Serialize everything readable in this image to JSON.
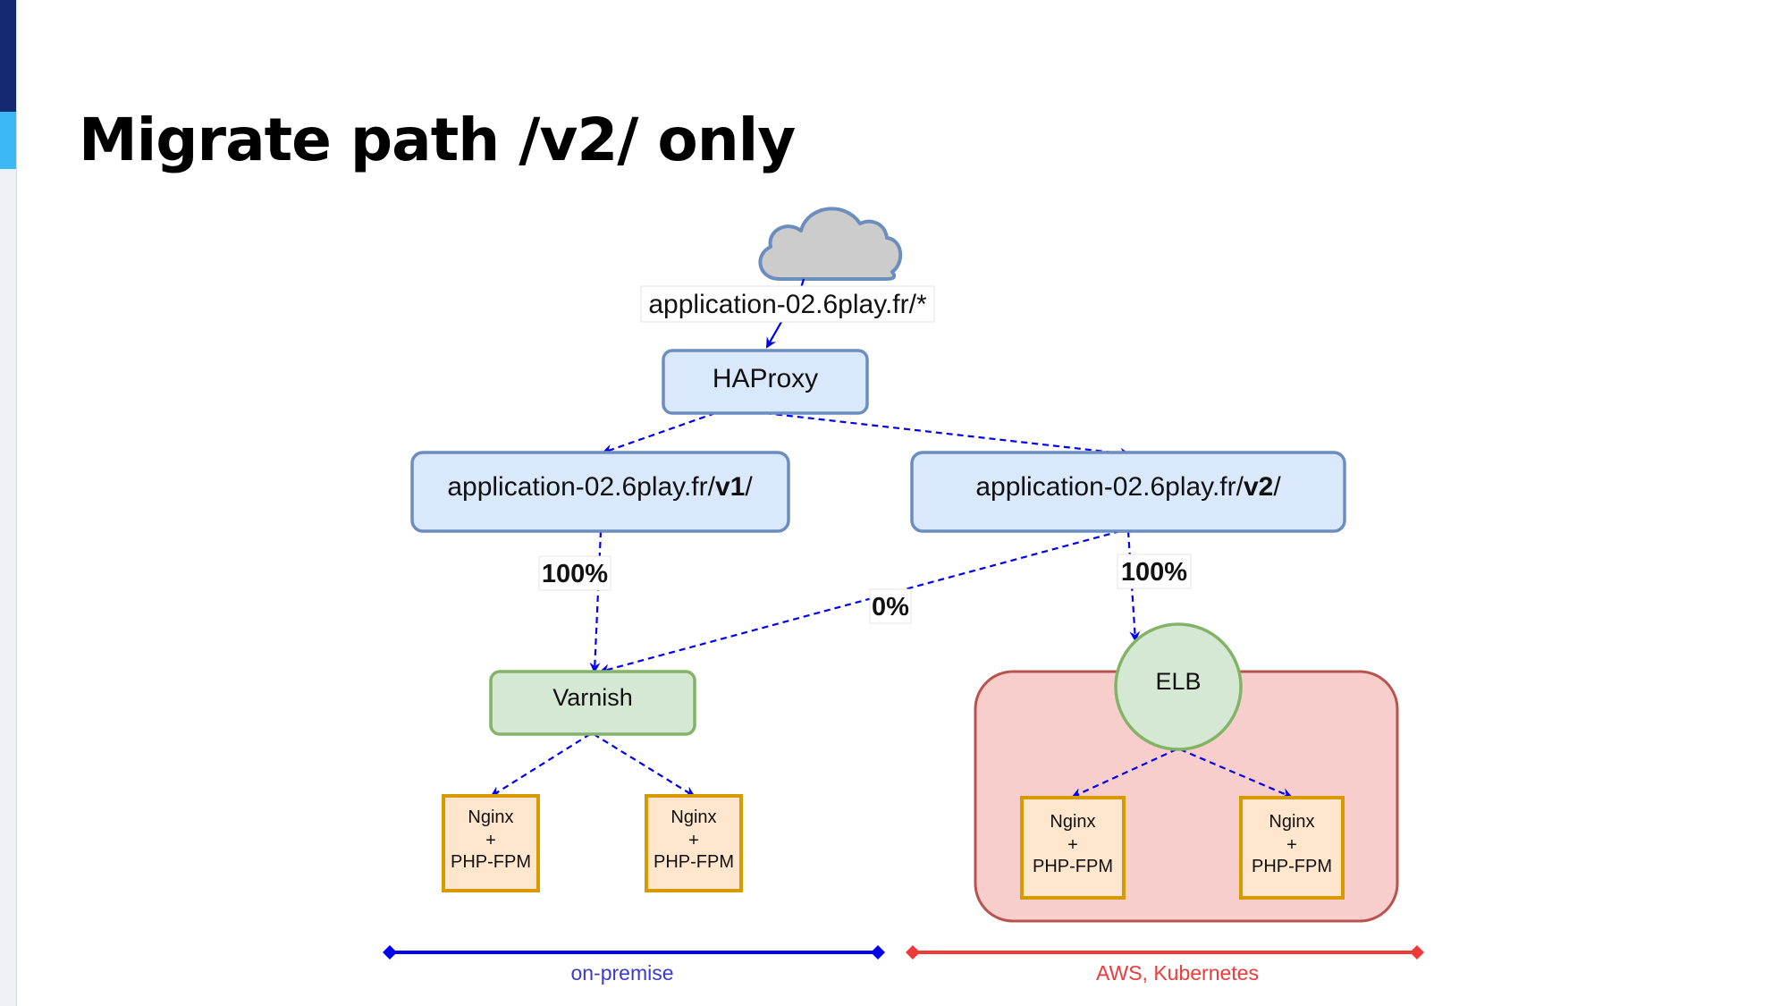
{
  "slide": {
    "title": "Migrate path /v2/ only"
  },
  "diagram": {
    "internet_label": "application-02.6play.fr/*",
    "haproxy": "HAProxy",
    "v1": {
      "prefix": "application-02.6play.fr/",
      "bold": "v1",
      "suffix": "/"
    },
    "v2": {
      "prefix": "application-02.6play.fr/",
      "bold": "v2",
      "suffix": "/"
    },
    "edges": {
      "v1_to_varnish": "100%",
      "v2_to_varnish": "0%",
      "v2_to_elb": "100%"
    },
    "varnish": "Varnish",
    "elb": "ELB",
    "backend": {
      "line1": "Nginx",
      "line2": "+",
      "line3": "PHP-FPM"
    },
    "zones": {
      "on_premise": "on-premise",
      "cloud": "AWS, Kubernetes"
    },
    "colors": {
      "edge": "#0000ee",
      "on_premise": "#0000ee",
      "cloud": "#f03a3a",
      "app_fill": "#dae8fc",
      "app_stroke": "#6c8ebf",
      "green_fill": "#d5e8d4",
      "green_stroke": "#82b366",
      "orange_fill": "#ffe6cc",
      "orange_stroke": "#d79b00",
      "red_fill": "#f8cecc",
      "red_stroke": "#b85450",
      "cloud_fill": "#cccccc"
    }
  }
}
